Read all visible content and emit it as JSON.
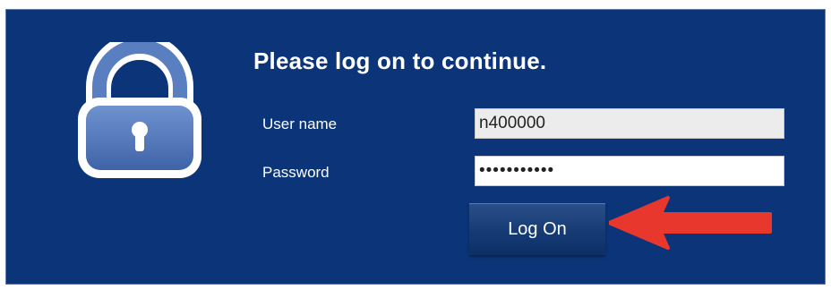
{
  "dialog": {
    "title": "Please log on to continue.",
    "lock_icon": "lock-icon"
  },
  "form": {
    "username_label": "User name",
    "username_value": "n400000",
    "password_label": "Password",
    "password_value": "•••••••••••",
    "submit_label": "Log On"
  },
  "annotation": {
    "arrow_icon": "red-arrow-icon",
    "arrow_color": "#e8372c"
  },
  "colors": {
    "panel_background": "#0b3578",
    "lock_blue": "#5a7fc0",
    "text": "#ffffff"
  }
}
